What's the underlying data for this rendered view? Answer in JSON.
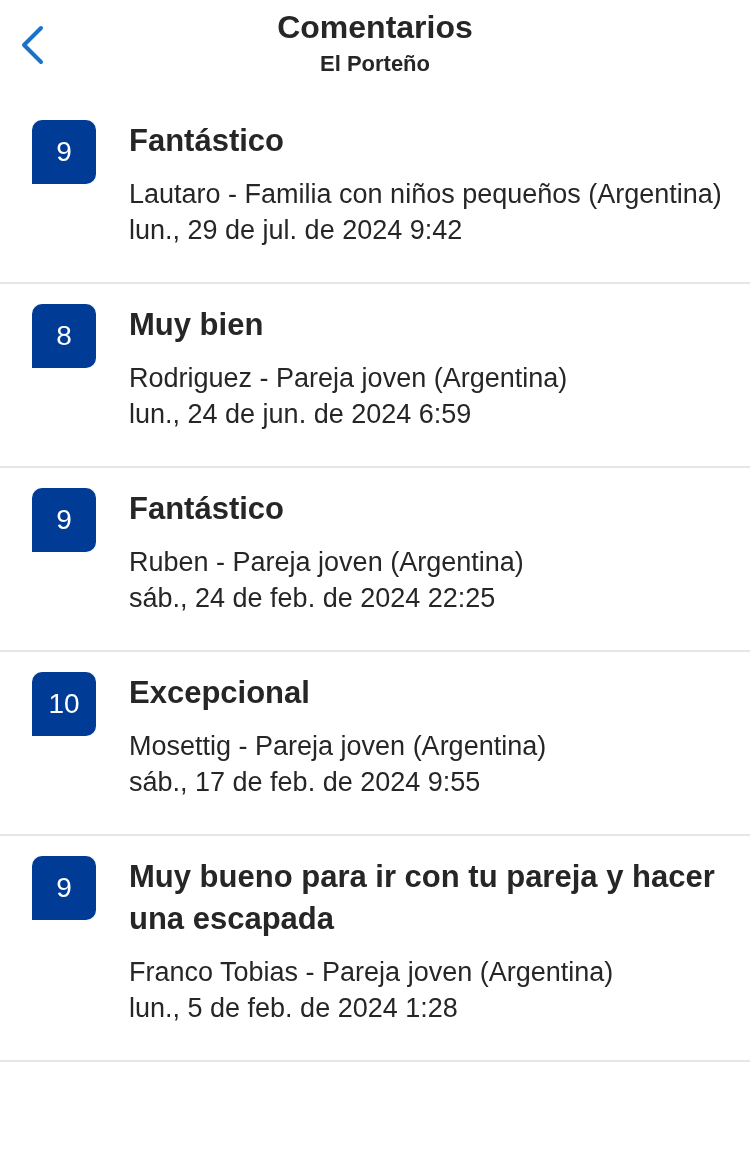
{
  "header": {
    "title": "Comentarios",
    "subtitle": "El Porteño"
  },
  "reviews": [
    {
      "score": "9",
      "title": "Fantástico",
      "author": "Lautaro - Familia con niños pequeños (Argentina)",
      "date": "lun., 29 de jul. de 2024 9:42"
    },
    {
      "score": "8",
      "title": "Muy bien",
      "author": "Rodriguez - Pareja joven (Argentina)",
      "date": "lun., 24 de jun. de 2024 6:59"
    },
    {
      "score": "9",
      "title": "Fantástico",
      "author": "Ruben - Pareja joven (Argentina)",
      "date": "sáb., 24 de feb. de 2024 22:25"
    },
    {
      "score": "10",
      "title": "Excepcional",
      "author": "Mosettig - Pareja joven (Argentina)",
      "date": "sáb., 17 de feb. de 2024 9:55"
    },
    {
      "score": "9",
      "title": "Muy bueno para ir con tu pareja y hacer una escapada",
      "author": "Franco Tobias - Pareja joven (Argentina)",
      "date": "lun., 5 de feb. de 2024 1:28"
    }
  ]
}
